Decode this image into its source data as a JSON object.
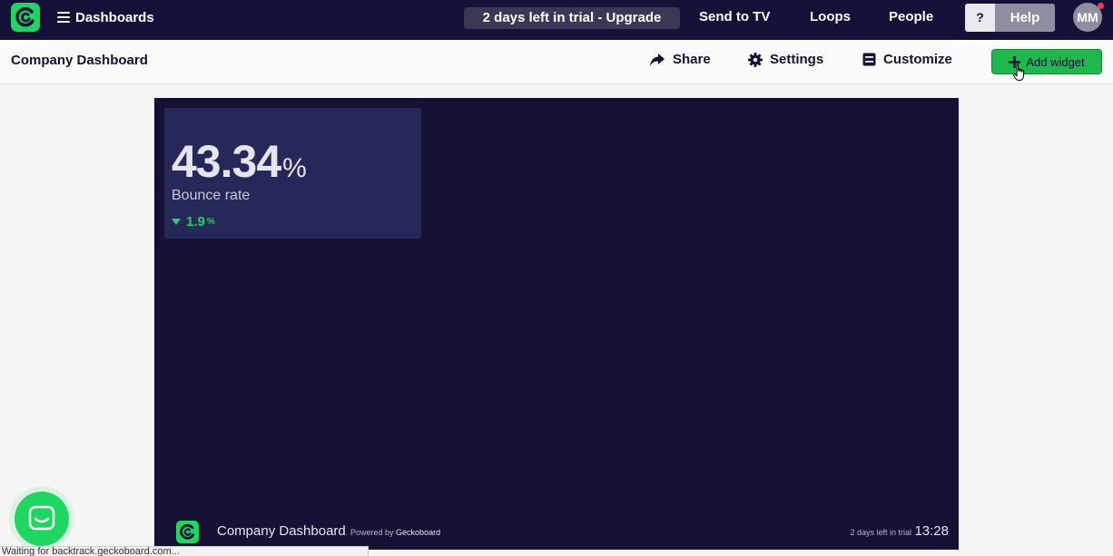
{
  "topnav": {
    "menu_label": "Dashboards",
    "trial_banner": "2 days left in trial - Upgrade",
    "links": [
      "Send to TV",
      "Loops",
      "People"
    ],
    "help_icon_label": "?",
    "help_label": "Help",
    "avatar_initials": "MM"
  },
  "subbar": {
    "title": "Company Dashboard",
    "share_label": "Share",
    "settings_label": "Settings",
    "customize_label": "Customize",
    "add_widget_label": "Add widget"
  },
  "widget": {
    "value": "43.34",
    "unit": "%",
    "label": "Bounce rate",
    "delta_value": "1.9",
    "delta_unit": "%",
    "delta_direction": "down"
  },
  "board_footer": {
    "title": "Company Dashboard",
    "powered_prefix": "Powered by",
    "powered_brand": "Geckoboard",
    "trial_note": "2 days left in trial",
    "time": "13:28"
  },
  "status_bar": {
    "text": "Waiting for backtrack.geckoboard.com..."
  },
  "colors": {
    "nav_bg": "#15123a",
    "board_bg": "#161235",
    "widget_bg": "#27285a",
    "accent_green": "#1ed760"
  }
}
